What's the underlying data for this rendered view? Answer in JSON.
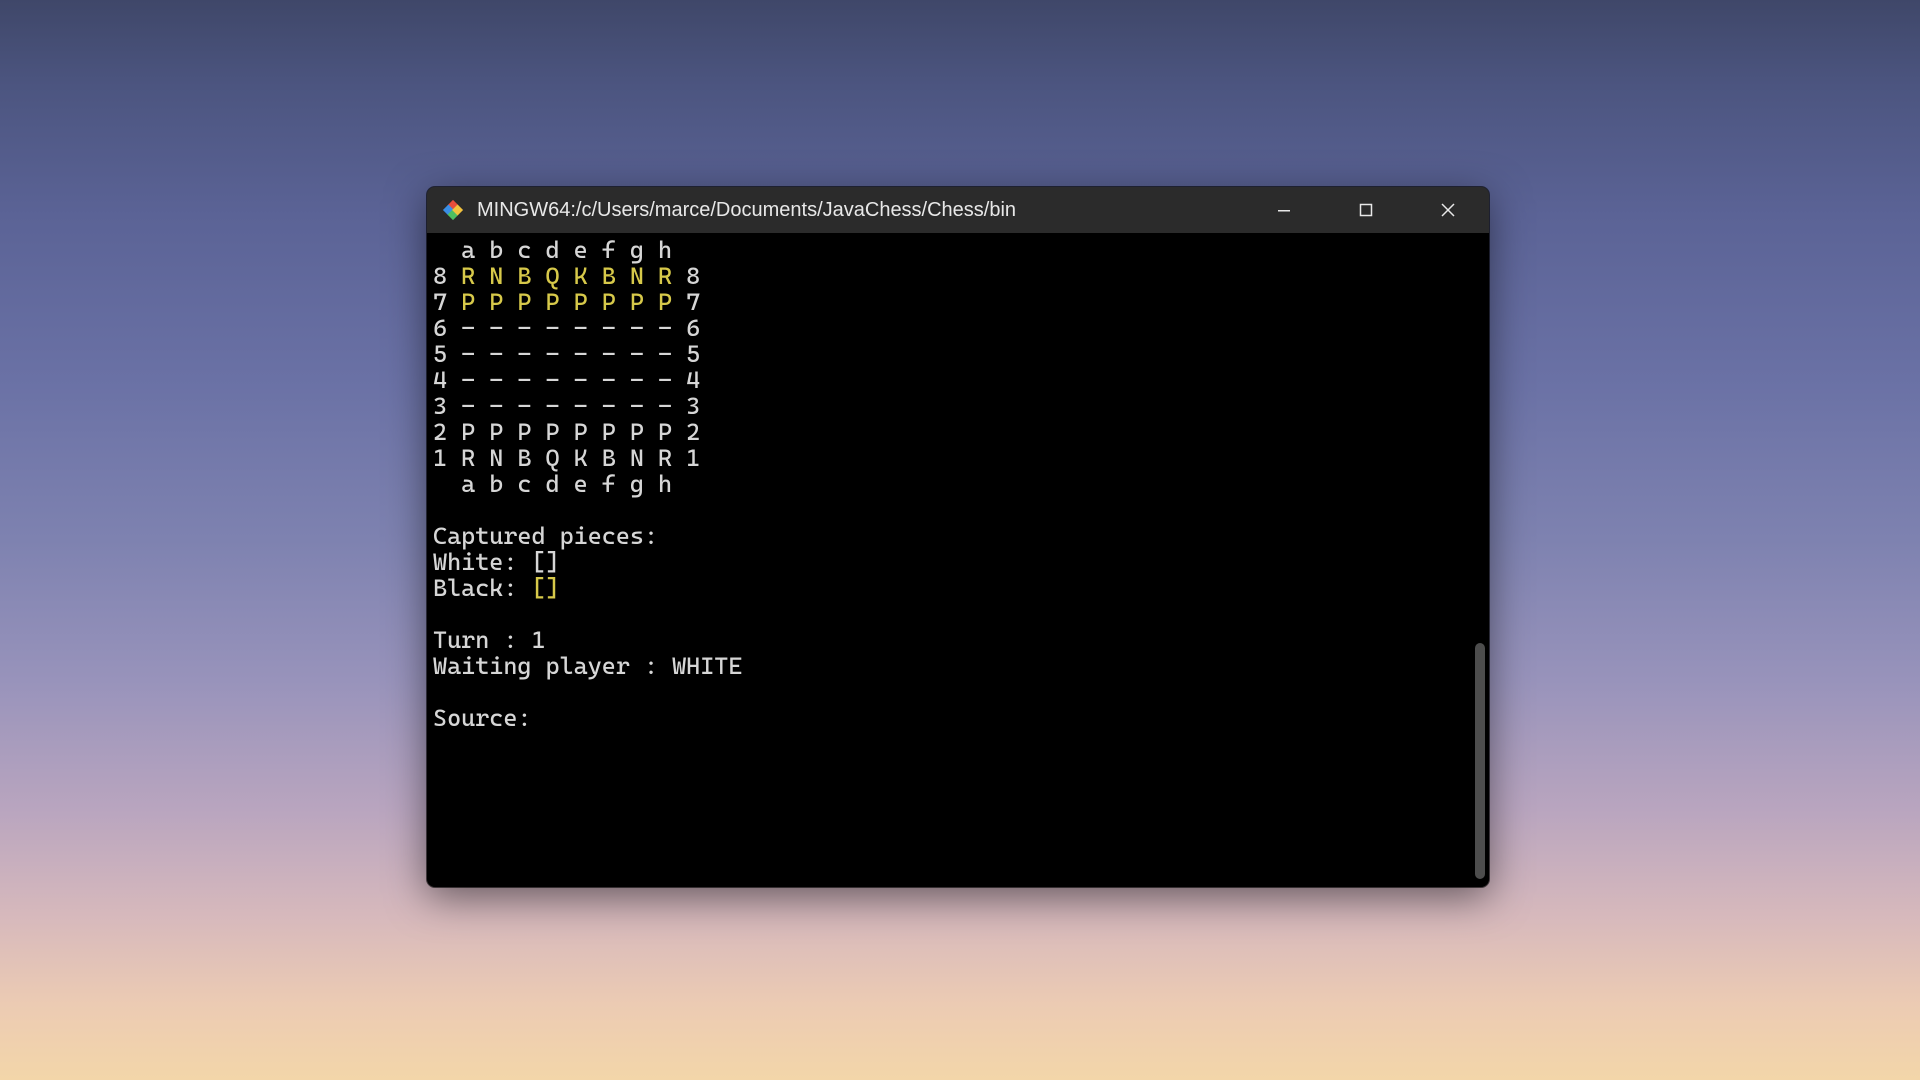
{
  "window": {
    "title": "MINGW64:/c/Users/marce/Documents/JavaChess/Chess/bin"
  },
  "controls": {
    "minimize": "Minimize",
    "maximize": "Maximize",
    "close": "Close"
  },
  "board": {
    "columns_top": "  a b c d e f g h",
    "rank8_left": "8 ",
    "rank8_pieces": "R N B Q K B N R",
    "rank8_right": " 8",
    "rank7_left": "7 ",
    "rank7_pieces": "P P P P P P P P",
    "rank7_right": " 7",
    "rank6": "6 - - - - - - - - 6",
    "rank5": "5 - - - - - - - - 5",
    "rank4": "4 - - - - - - - - 4",
    "rank3": "3 - - - - - - - - 3",
    "rank2": "2 P P P P P P P P 2",
    "rank1": "1 R N B Q K B N R 1",
    "columns_bottom": "  a b c d e f g h"
  },
  "status": {
    "captured_header": "Captured pieces:",
    "white_label": "White: ",
    "white_value": "[]",
    "black_label": "Black: ",
    "black_value": "[]",
    "turn_line": "Turn : 1",
    "waiting_line": "Waiting player : WHITE",
    "prompt": "Source: "
  }
}
